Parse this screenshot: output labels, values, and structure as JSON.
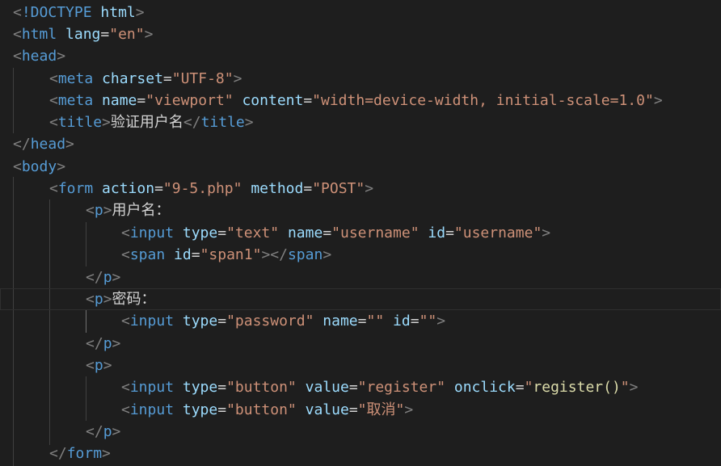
{
  "lines": [
    "<!DOCTYPE html>",
    "<html lang=\"en\">",
    "<head>",
    "<meta charset=\"UTF-8\">",
    "<meta name=\"viewport\" content=\"width=device-width, initial-scale=1.0\">",
    "<title>验证用户名</title>",
    "</head>",
    "<body>",
    "<form action=\"9-5.php\" method=\"POST\">",
    "<p>用户名：",
    "<input type=\"text\" name=\"username\" id=\"username\">",
    "<span id=\"span1\"></span>",
    "</p>",
    "<p>密码：",
    "<input type=\"password\" name=\"\" id=\"\">",
    "</p>",
    "<p>",
    "<input type=\"button\" value=\"register\" onclick=\"register()\">",
    "<input type=\"button\" value=\"取消\">",
    "</p>",
    "</form>"
  ],
  "tokens": {
    "lt": "<",
    "gt": ">",
    "lt_slash": "</",
    "eq": "=",
    "doctype_bang": "!DOCTYPE",
    "html_tag": "html",
    "lang_attr": "lang",
    "lang_val": "\"en\"",
    "head_tag": "head",
    "meta_tag": "meta",
    "charset_attr": "charset",
    "charset_val": "\"UTF-8\"",
    "name_attr": "name",
    "viewport_val": "\"viewport\"",
    "content_attr": "content",
    "content_val": "\"width=device-width, initial-scale=1.0\"",
    "title_tag": "title",
    "title_text": "验证用户名",
    "body_tag": "body",
    "form_tag": "form",
    "action_attr": "action",
    "action_val": "\"9-5.php\"",
    "method_attr": "method",
    "method_val": "\"POST\"",
    "p_tag": "p",
    "p1_text": "用户名：",
    "input_tag": "input",
    "type_attr": "type",
    "text_val": "\"text\"",
    "username_val": "\"username\"",
    "id_attr": "id",
    "span_tag": "span",
    "span1_val": "\"span1\"",
    "p2_text": "密码：",
    "password_val": "\"password\"",
    "empty_val": "\"\"",
    "button_val": "\"button\"",
    "value_attr": "value",
    "register_val": "\"register\"",
    "onclick_attr": "onclick",
    "quote": "\"",
    "register_call": "register()",
    "cancel_val": "\"取消\""
  },
  "colors": {
    "background": "#1e1e1e",
    "tag": "#569cd6",
    "attribute": "#9cdcfe",
    "string": "#ce9178",
    "punctuation": "#808080",
    "text": "#d4d4d4",
    "function": "#dcdcaa"
  }
}
